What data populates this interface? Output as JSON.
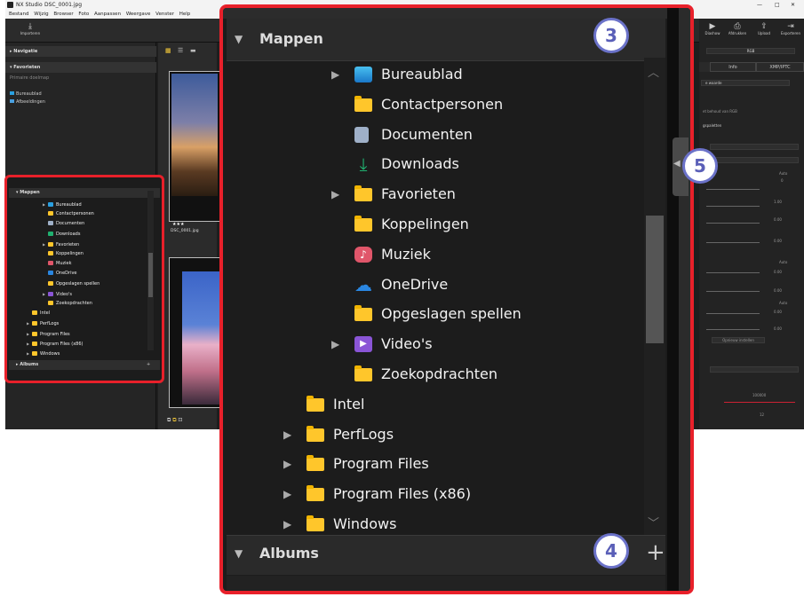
{
  "app": {
    "name": "NX Studio",
    "file": "DSC_0001.jpg"
  },
  "menu": [
    "Bestand",
    "Wijzig",
    "Browser",
    "Foto",
    "Aanpassen",
    "Weergave",
    "Venster",
    "Help"
  ],
  "toolbar": {
    "import_label": "Importeren"
  },
  "right_toolbar": [
    "Diashow",
    "Afdrukken",
    "Upload",
    "Exporteren"
  ],
  "left_panel": {
    "navigation": "Navigatie",
    "favorites": "Favorieten",
    "primary_folder": "Primaire doelmap",
    "fav_items": [
      "Bureaublad",
      "Afbeeldingen"
    ]
  },
  "thumb": {
    "rating": "★★★",
    "name": "DSC_0001.jpg"
  },
  "right_panel": {
    "rgb": "RGB",
    "tabs": [
      "Info",
      "XMP/IPTC"
    ],
    "value_label": "e waarde",
    "rgb_note": "et behoud van RGB",
    "palettes": "gspaletten",
    "auto": "Auto",
    "vals": [
      "0",
      "1.00",
      "0.00",
      "0.00",
      "0.00",
      "0.00",
      "0.00",
      "0.00"
    ],
    "optimize": "Opnieuw instellen",
    "max": "100000",
    "s12": "12"
  },
  "folders": {
    "header": "Mappen",
    "items": [
      {
        "label": "Bureaublad",
        "expand": true,
        "icon": "desktop"
      },
      {
        "label": "Contactpersonen",
        "expand": false,
        "icon": "folder"
      },
      {
        "label": "Documenten",
        "expand": false,
        "icon": "document"
      },
      {
        "label": "Downloads",
        "expand": false,
        "icon": "download"
      },
      {
        "label": "Favorieten",
        "expand": true,
        "icon": "folder"
      },
      {
        "label": "Koppelingen",
        "expand": false,
        "icon": "folder"
      },
      {
        "label": "Muziek",
        "expand": false,
        "icon": "music"
      },
      {
        "label": "OneDrive",
        "expand": false,
        "icon": "cloud"
      },
      {
        "label": "Opgeslagen spellen",
        "expand": false,
        "icon": "folder"
      },
      {
        "label": "Video's",
        "expand": true,
        "icon": "video"
      },
      {
        "label": "Zoekopdrachten",
        "expand": false,
        "icon": "folder"
      }
    ],
    "root_items": [
      {
        "label": "Intel",
        "expand": false
      },
      {
        "label": "PerfLogs",
        "expand": true
      },
      {
        "label": "Program Files",
        "expand": true
      },
      {
        "label": "Program Files (x86)",
        "expand": true
      },
      {
        "label": "Windows",
        "expand": true
      }
    ]
  },
  "albums": {
    "header": "Albums"
  },
  "callouts": [
    "3",
    "4",
    "5"
  ],
  "colors": {
    "callout_border": "#e8202a",
    "badge": "#6b72c9",
    "folder": "#ffc62b"
  }
}
